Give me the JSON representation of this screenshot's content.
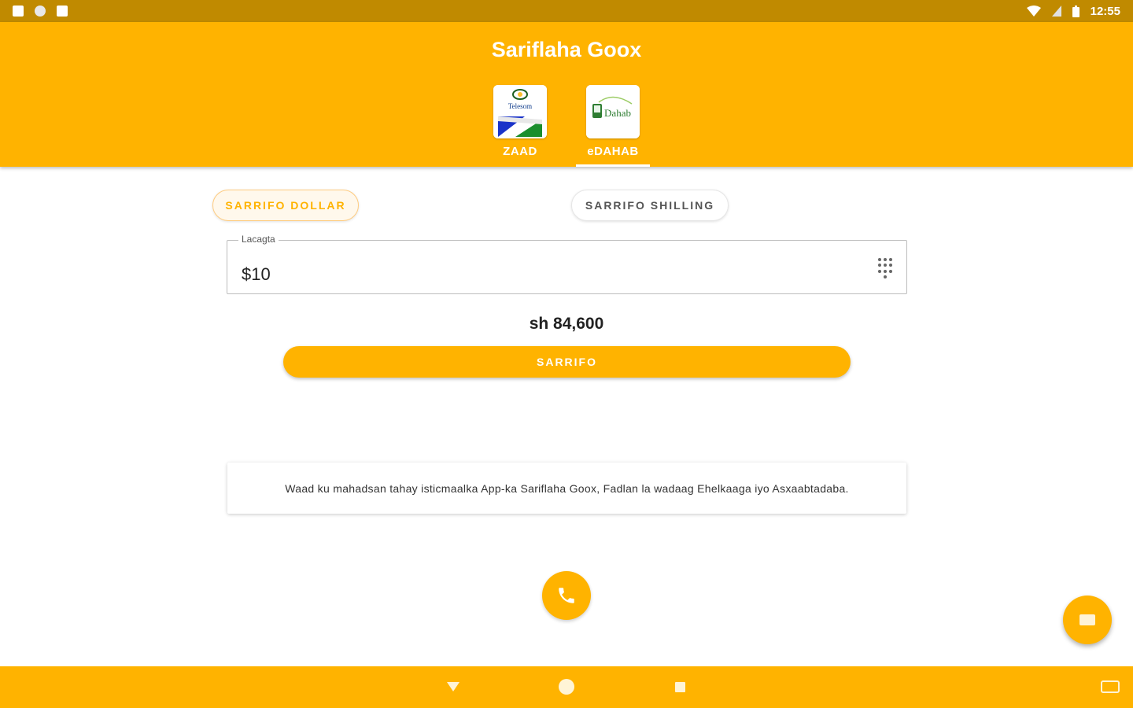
{
  "status_bar": {
    "time": "12:55"
  },
  "header": {
    "title": "Sariflaha Goox",
    "tabs": [
      {
        "label": "ZAAD",
        "logo_text": "Telesom",
        "active": false
      },
      {
        "label": "eDAHAB",
        "logo_text": "Dahab",
        "active": true
      }
    ]
  },
  "toggle": {
    "dollar_label": "SARRIFO DOLLAR",
    "shilling_label": "SARRIFO SHILLING",
    "selected": "dollar"
  },
  "amount_field": {
    "label": "Lacagta",
    "value": "$10"
  },
  "result": {
    "text": "sh 84,600"
  },
  "convert_button": {
    "label": "SARRIFO"
  },
  "message_card": {
    "text": "Waad ku mahadsan tahay isticmaalka App-ka Sariflaha Goox, Fadlan la wadaag Ehelkaaga iyo Asxaabtadaba."
  },
  "colors": {
    "accent": "#ffb300",
    "status_bar": "#c08a00",
    "background": "#ffffff"
  },
  "icons": {
    "call": "phone-icon",
    "chat": "chat-icon"
  }
}
